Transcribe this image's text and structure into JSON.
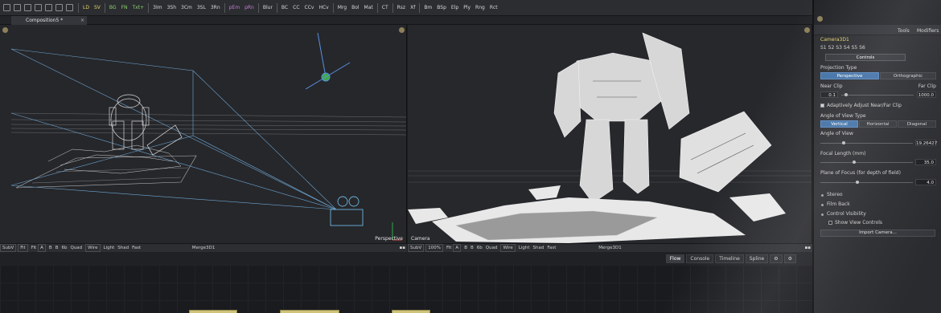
{
  "toolbar": {
    "icons": [
      "new-icon",
      "open-icon",
      "save-icon",
      "select-icon",
      "cut-icon",
      "copy-icon",
      "paste-icon"
    ],
    "buttons": [
      "LD",
      "SV",
      "BG",
      "FN",
      "Txt+",
      "3Im",
      "3Sh",
      "3Cm",
      "3SL",
      "3Rn",
      "pEm",
      "pRn",
      "Blur",
      "BC",
      "CC",
      "CCv",
      "HCv",
      "Mrg",
      "Bol",
      "Mat",
      "CT",
      "Rsz",
      "Xf",
      "Bm",
      "BSp",
      "Elp",
      "Ply",
      "Rng",
      "Rct"
    ]
  },
  "tab": {
    "title": "Composition5 *",
    "close": "×"
  },
  "viewer_left": {
    "view_label": "Perspective"
  },
  "viewer_right": {
    "view_label": "Camera"
  },
  "vbar_left": {
    "subv": "SubV",
    "fit": "Fit",
    "fit2": "Fit",
    "a": "A",
    "b": "B",
    "c": "B",
    "ab": "6b",
    "quad": "Quad",
    "wire": "Wire",
    "light": "Light",
    "shad": "Shad",
    "fast": "Fast",
    "node": "Merge3D1",
    "menu": "▪▪"
  },
  "vbar_right": {
    "subv": "SubV",
    "zoom": "100%",
    "fit": "Fit",
    "a": "A",
    "b": "B",
    "c": "B",
    "ab": "6b",
    "quad": "Quad",
    "wire": "Wire",
    "light": "Light",
    "shad": "Shad",
    "fast": "Fast",
    "node": "Merge3D1",
    "menu": "▪▪"
  },
  "node_tabs": [
    "Flow",
    "Console",
    "Timeline",
    "Spline"
  ],
  "inspector": {
    "tabs": {
      "tools": "Tools",
      "modifiers": "Modifiers"
    },
    "node_name": "Camera3D1",
    "slots": [
      "S1",
      "S2",
      "S3",
      "S4",
      "S5",
      "S6"
    ],
    "controls_tab": "Controls",
    "projection_type_label": "Projection Type",
    "projection_options": [
      "Perspective",
      "Orthographic"
    ],
    "near_clip_label": "Near Clip",
    "far_clip_label": "Far Clip",
    "near_clip_value": "0.1",
    "far_clip_value": "1000.0",
    "adaptive_label": "Adaptively Adjust Near/Far Clip",
    "angle_type_label": "Angle of View Type",
    "angle_type_options": [
      "Vertical",
      "Horizontal",
      "Diagonal"
    ],
    "angle_of_view_label": "Angle of View",
    "angle_of_view_value": "19.26427",
    "focal_length_label": "Focal Length (mm)",
    "focal_length_value": "35.0",
    "plane_focus_label": "Plane of Focus (for depth of field)",
    "plane_focus_value": "4.0",
    "sections": [
      "Stereo",
      "Film Back",
      "Control Visibility"
    ],
    "show_view_controls_label": "Show View Controls",
    "import_button": "Import Camera..."
  }
}
